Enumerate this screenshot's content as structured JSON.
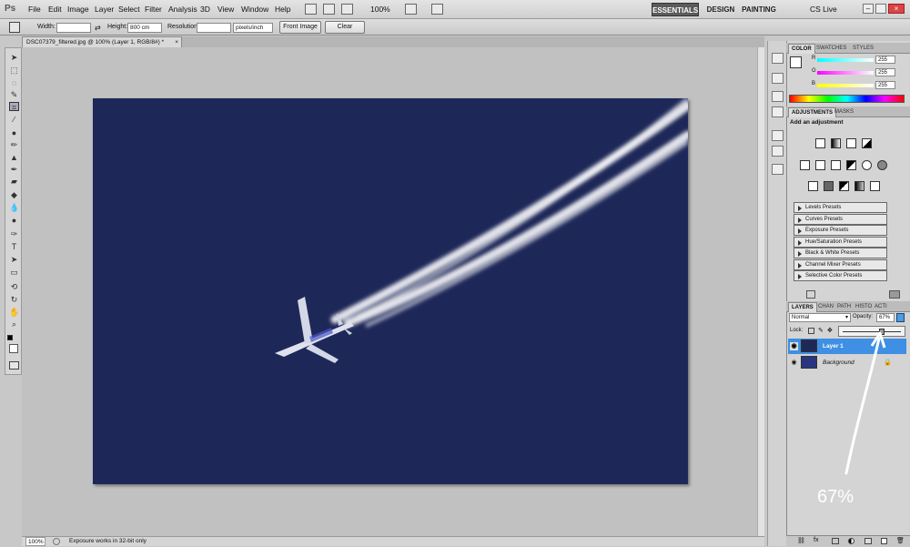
{
  "app": {
    "logo": "Ps"
  },
  "menu": [
    "File",
    "Edit",
    "Image",
    "Layer",
    "Select",
    "Filter",
    "Analysis",
    "3D",
    "View",
    "Window",
    "Help"
  ],
  "menubar_extra": {
    "zoom": "100%",
    "cs_live": "CS Live"
  },
  "workspaces": {
    "essentials": "ESSENTIALS",
    "design": "DESIGN",
    "painting": "PAINTING"
  },
  "options": {
    "width_label": "Width:",
    "width_value": "",
    "height_label": "Height:",
    "height_value": "800 cm",
    "resolution_label": "Resolution:",
    "resolution_value": "",
    "resolution_unit": "pixels/inch",
    "front_image": "Front Image",
    "clear": "Clear"
  },
  "document": {
    "tab_title": "DSC07379_filtered.jpg @ 100% (Layer 1, RGB/8#) *"
  },
  "status": {
    "zoom": "100%",
    "message": "Exposure works in 32-bit only"
  },
  "color_panel": {
    "tabs": [
      "COLOR",
      "SWATCHES",
      "STYLES"
    ],
    "channels": [
      {
        "label": "R",
        "value": "255"
      },
      {
        "label": "G",
        "value": "255"
      },
      {
        "label": "B",
        "value": "255"
      }
    ]
  },
  "adjustments_panel": {
    "tabs": [
      "ADJUSTMENTS",
      "MASKS"
    ],
    "heading": "Add an adjustment",
    "presets": [
      "Levels Presets",
      "Curves Presets",
      "Exposure Presets",
      "Hue/Saturation Presets",
      "Black & White Presets",
      "Channel Mixer Presets",
      "Selective Color Presets"
    ]
  },
  "layers_panel": {
    "tabs": [
      "LAYERS",
      "CHAN",
      "PATH",
      "HISTO",
      "ACTI"
    ],
    "blend_mode": "Normal",
    "opacity_label": "Opacity:",
    "opacity_value": "67%",
    "opacity_fraction": 0.67,
    "lock_label": "Lock:",
    "layers": [
      {
        "name": "Layer 1",
        "selected": true
      },
      {
        "name": "Background",
        "selected": false
      }
    ]
  },
  "annotation": {
    "text": "67%"
  },
  "colors": {
    "image_bg": "#1e2858",
    "selected_layer": "#3f8fe4",
    "arrow": "#ffffff"
  }
}
